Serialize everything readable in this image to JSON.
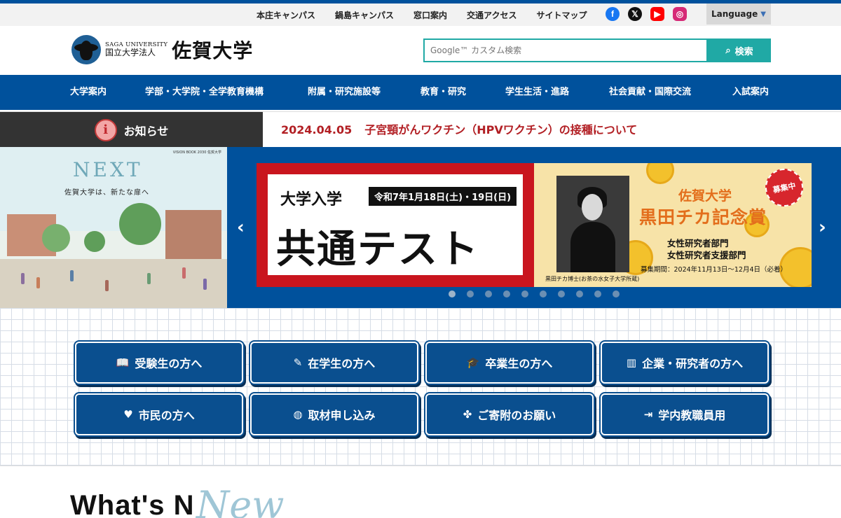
{
  "utility_nav": {
    "links": [
      "本庄キャンパス",
      "鍋島キャンパス",
      "窓口案内",
      "交通アクセス",
      "サイトマップ"
    ],
    "language_label": "Language"
  },
  "social_icons": [
    {
      "name": "facebook-icon",
      "color": "#1877f2"
    },
    {
      "name": "x-icon",
      "color": "#111111"
    },
    {
      "name": "youtube-icon",
      "color": "#ff0000"
    },
    {
      "name": "instagram-icon",
      "color": "#d62976"
    }
  ],
  "header": {
    "logo_en": "SAGA UNIVERSITY",
    "logo_corp": "国立大学法人",
    "logo_name": "佐賀大学",
    "search_placeholder": "Google™ カスタム検索",
    "search_button": "検索"
  },
  "global_nav": [
    "大学案内",
    "学部・大学院・全学教育機構",
    "附属・研究施設等",
    "教育・研究",
    "学生生活・進路",
    "社会貢献・国際交流",
    "入試案内"
  ],
  "news": {
    "label": "お知らせ",
    "date": "2024.04.05",
    "headline": "子宮頸がんワクチン（HPVワクチン）の接種について"
  },
  "hero": {
    "vision_banner": {
      "tag": "VISION BOOK 2030 佐賀大学",
      "title": "NEXT",
      "subtitle": "佐賀大学は、新たな扉へ"
    },
    "slide_exam": {
      "line1": "大学入学",
      "date": "令和7年1月18日(土)・19日(日)",
      "line2": "共通テスト"
    },
    "slide_award": {
      "badge": "募集中",
      "title1": "佐賀大学",
      "title2": "黒田チカ記念賞",
      "dept1": "女性研究者部門",
      "dept2": "女性研究者支援部門",
      "period": "募集期間：2024年11月13日～12月4日（必着）",
      "caption": "黒田チカ博士(お茶の水女子大学所蔵)"
    },
    "dots_count": 10,
    "active_dot": 0
  },
  "quick_links": [
    {
      "label": "受験生の方へ",
      "icon": "book-icon"
    },
    {
      "label": "在学生の方へ",
      "icon": "pencil-icon"
    },
    {
      "label": "卒業生の方へ",
      "icon": "graduation-cap-icon"
    },
    {
      "label": "企業・研究者の方へ",
      "icon": "building-icon"
    },
    {
      "label": "市民の方へ",
      "icon": "hand-heart-icon"
    },
    {
      "label": "取材申し込み",
      "icon": "globe-icon"
    },
    {
      "label": "ご寄附のお願い",
      "icon": "clover-icon"
    },
    {
      "label": "学内教職員用",
      "icon": "sign-in-icon"
    }
  ],
  "whats_new": {
    "title": "What's N",
    "script": "New"
  },
  "colors": {
    "brand_blue": "#00519c",
    "search_teal": "#20a9a5",
    "news_red": "#b21f24",
    "exam_red": "#c9151e"
  }
}
